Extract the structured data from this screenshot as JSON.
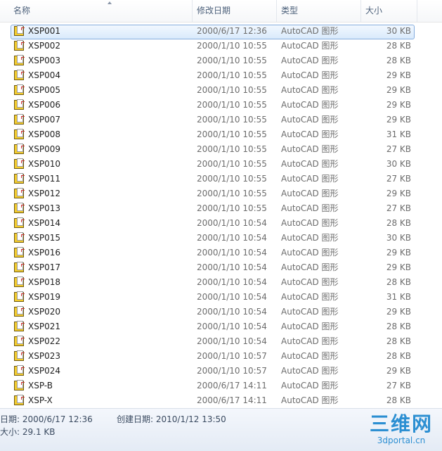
{
  "columns": {
    "name": "名称",
    "date": "修改日期",
    "type": "类型",
    "size": "大小"
  },
  "files": [
    {
      "name": "XSP001",
      "date": "2000/6/17 12:36",
      "type": "AutoCAD 图形",
      "size": "30 KB",
      "selected": true
    },
    {
      "name": "XSP002",
      "date": "2000/1/10 10:55",
      "type": "AutoCAD 图形",
      "size": "28 KB"
    },
    {
      "name": "XSP003",
      "date": "2000/1/10 10:55",
      "type": "AutoCAD 图形",
      "size": "28 KB"
    },
    {
      "name": "XSP004",
      "date": "2000/1/10 10:55",
      "type": "AutoCAD 图形",
      "size": "29 KB"
    },
    {
      "name": "XSP005",
      "date": "2000/1/10 10:55",
      "type": "AutoCAD 图形",
      "size": "29 KB"
    },
    {
      "name": "XSP006",
      "date": "2000/1/10 10:55",
      "type": "AutoCAD 图形",
      "size": "29 KB"
    },
    {
      "name": "XSP007",
      "date": "2000/1/10 10:55",
      "type": "AutoCAD 图形",
      "size": "29 KB"
    },
    {
      "name": "XSP008",
      "date": "2000/1/10 10:55",
      "type": "AutoCAD 图形",
      "size": "31 KB"
    },
    {
      "name": "XSP009",
      "date": "2000/1/10 10:55",
      "type": "AutoCAD 图形",
      "size": "27 KB"
    },
    {
      "name": "XSP010",
      "date": "2000/1/10 10:55",
      "type": "AutoCAD 图形",
      "size": "30 KB"
    },
    {
      "name": "XSP011",
      "date": "2000/1/10 10:55",
      "type": "AutoCAD 图形",
      "size": "27 KB"
    },
    {
      "name": "XSP012",
      "date": "2000/1/10 10:55",
      "type": "AutoCAD 图形",
      "size": "29 KB"
    },
    {
      "name": "XSP013",
      "date": "2000/1/10 10:55",
      "type": "AutoCAD 图形",
      "size": "27 KB"
    },
    {
      "name": "XSP014",
      "date": "2000/1/10 10:54",
      "type": "AutoCAD 图形",
      "size": "28 KB"
    },
    {
      "name": "XSP015",
      "date": "2000/1/10 10:54",
      "type": "AutoCAD 图形",
      "size": "30 KB"
    },
    {
      "name": "XSP016",
      "date": "2000/1/10 10:54",
      "type": "AutoCAD 图形",
      "size": "29 KB"
    },
    {
      "name": "XSP017",
      "date": "2000/1/10 10:54",
      "type": "AutoCAD 图形",
      "size": "29 KB"
    },
    {
      "name": "XSP018",
      "date": "2000/1/10 10:54",
      "type": "AutoCAD 图形",
      "size": "28 KB"
    },
    {
      "name": "XSP019",
      "date": "2000/1/10 10:54",
      "type": "AutoCAD 图形",
      "size": "31 KB"
    },
    {
      "name": "XSP020",
      "date": "2000/1/10 10:54",
      "type": "AutoCAD 图形",
      "size": "29 KB"
    },
    {
      "name": "XSP021",
      "date": "2000/1/10 10:54",
      "type": "AutoCAD 图形",
      "size": "28 KB"
    },
    {
      "name": "XSP022",
      "date": "2000/1/10 10:54",
      "type": "AutoCAD 图形",
      "size": "28 KB"
    },
    {
      "name": "XSP023",
      "date": "2000/1/10 10:57",
      "type": "AutoCAD 图形",
      "size": "28 KB"
    },
    {
      "name": "XSP024",
      "date": "2000/1/10 10:57",
      "type": "AutoCAD 图形",
      "size": "29 KB"
    },
    {
      "name": "XSP-B",
      "date": "2000/6/17 14:11",
      "type": "AutoCAD 图形",
      "size": "27 KB"
    },
    {
      "name": "XSP-X",
      "date": "2000/6/17 14:11",
      "type": "AutoCAD 图形",
      "size": "28 KB"
    }
  ],
  "details": {
    "modified": "日期: 2000/6/17 12:36",
    "created": "创建日期: 2010/1/12 13:50",
    "size": "大小: 29.1 KB"
  },
  "watermark": {
    "logo": "三维网",
    "url": "3dportal.cn"
  },
  "colors": {
    "header_text": "#4c607a",
    "selection_border": "#84acdd",
    "icon_yellow": "#f4cc2c",
    "watermark_blue": "#2c8fd2"
  }
}
